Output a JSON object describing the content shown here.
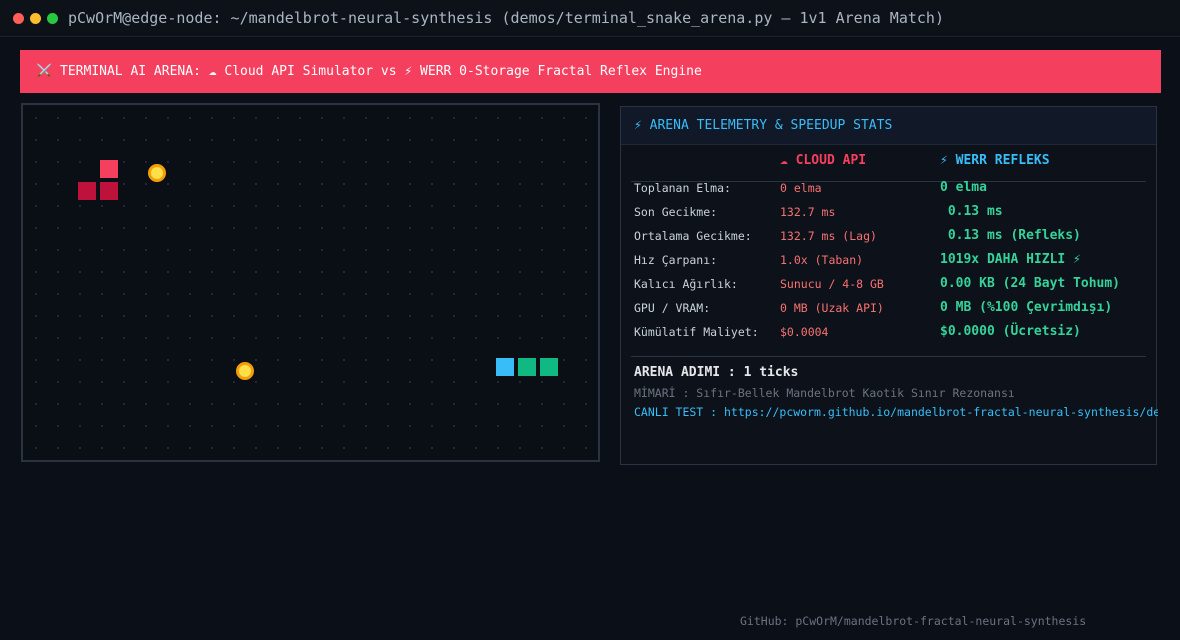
{
  "window": {
    "title": "pCwOrM@edge-node: ~/mandelbrot-neural-synthesis (demos/terminal_snake_arena.py — 1v1 Arena Match)"
  },
  "banner": {
    "text": "⚔️  TERMINAL AI ARENA: ☁ Cloud API Simulator vs ⚡ WERR 0-Storage Fractal Reflex Engine"
  },
  "colors": {
    "banner_bg": "#f43f5e",
    "cloud_head": "#f43f5e",
    "cloud_body": "#be123c",
    "werr_head": "#38bdf8",
    "werr_body": "#10b981",
    "apple": "#fde047",
    "accent": "#38bdf8"
  },
  "arena": {
    "grid_cols": 26,
    "grid_rows": 16,
    "cloud_snake": [
      [
        3,
        2
      ],
      [
        3,
        3
      ],
      [
        2,
        3
      ]
    ],
    "werr_snake": [
      [
        21,
        11
      ],
      [
        22,
        11
      ],
      [
        23,
        11
      ]
    ],
    "apples": [
      [
        5,
        2
      ],
      [
        9,
        11
      ]
    ]
  },
  "telemetry": {
    "title": "⚡ ARENA TELEMETRY & SPEEDUP STATS",
    "cloud_header": "☁ CLOUD API",
    "werr_header": "⚡ WERR REFLEKS",
    "rows": [
      {
        "label": "Toplanan Elma:",
        "cloud": "0 elma",
        "werr": "0 elma"
      },
      {
        "label": "Son Gecikme:",
        "cloud": "132.7 ms",
        "werr": " 0.13 ms"
      },
      {
        "label": "Ortalama Gecikme:",
        "cloud": "132.7 ms (Lag)",
        "werr": " 0.13 ms (Refleks)"
      },
      {
        "label": "Hız Çarpanı:",
        "cloud": "1.0x (Taban)",
        "werr": "1019x DAHA HIZLI ⚡"
      },
      {
        "label": "Kalıcı Ağırlık:",
        "cloud": "Sunucu / 4-8 GB",
        "werr": "0.00 KB (24 Bayt Tohum)"
      },
      {
        "label": "GPU / VRAM:",
        "cloud": "0 MB (Uzak API)",
        "werr": "0 MB (%100 Çevrimdışı)"
      },
      {
        "label": "Kümülatif Maliyet:",
        "cloud": "$0.0004",
        "werr": "$0.0000 (Ücretsiz)"
      }
    ],
    "step": "ARENA ADIMI : 1 ticks",
    "architecture": "MİMARİ     : Sıfır-Bellek Mandelbrot Kaotik Sınır Rezonansı",
    "live_test": "CANLI TEST : https://pcworm.github.io/mandelbrot-fractal-neural-synthesis/demos"
  },
  "footer": {
    "github": "GitHub: pCwOrM/mandelbrot-fractal-neural-synthesis"
  }
}
